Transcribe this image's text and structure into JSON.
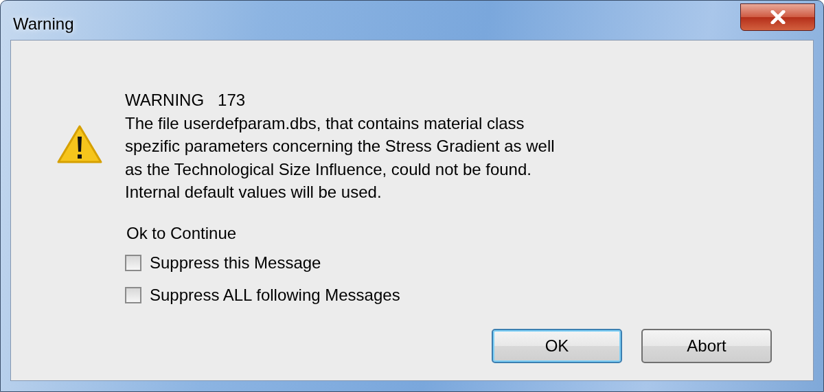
{
  "window": {
    "title": "Warning"
  },
  "message": {
    "heading": "WARNING   173",
    "lines": [
      "The file userdefparam.dbs, that contains material class",
      "spezific parameters concerning the Stress Gradient as well",
      "as the Technological Size Influence, could not be found.",
      "Internal default values will be used."
    ]
  },
  "prompt": "Ok to Continue",
  "options": [
    {
      "label": "Suppress this Message",
      "checked": false
    },
    {
      "label": "Suppress ALL following Messages",
      "checked": false
    }
  ],
  "buttons": [
    {
      "label": "OK",
      "default": true
    },
    {
      "label": "Abort",
      "default": false
    }
  ]
}
